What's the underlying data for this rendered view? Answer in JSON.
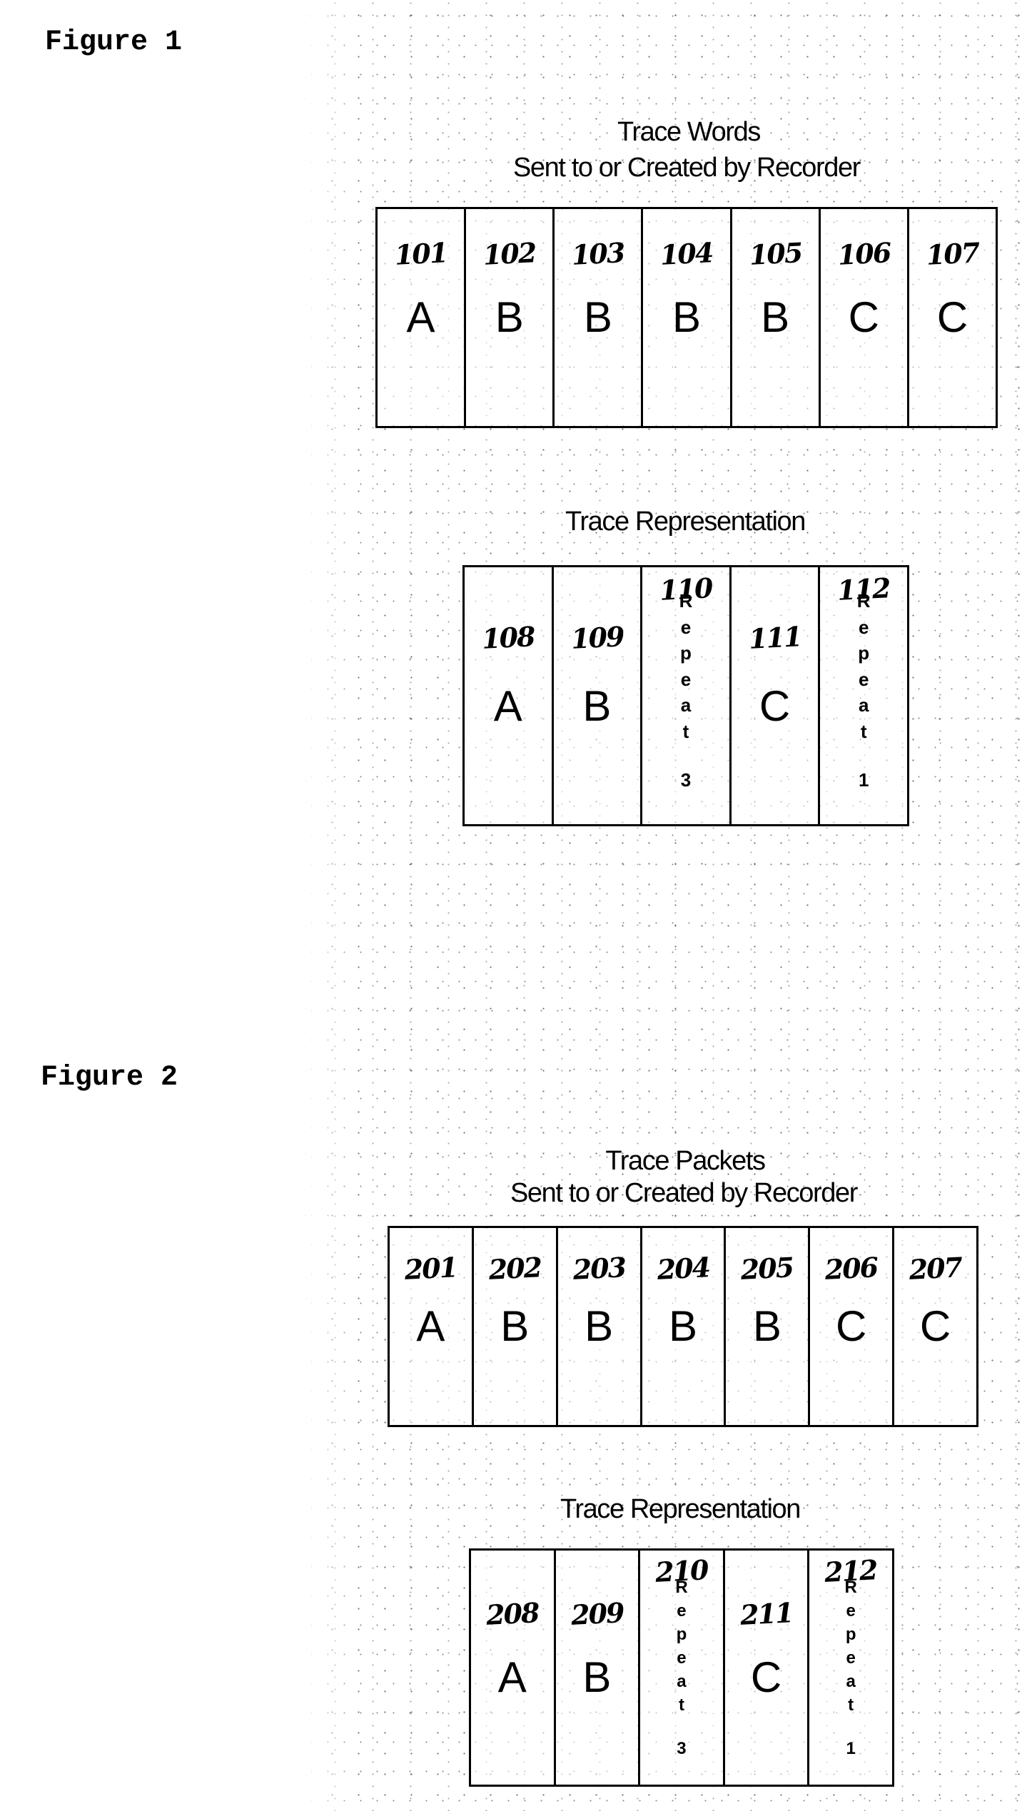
{
  "figure1": {
    "label": "Figure 1",
    "words_title": "Trace Words",
    "words_subtitle": "Sent to or Created by Recorder",
    "words": [
      {
        "ref": "101",
        "symbol": "A"
      },
      {
        "ref": "102",
        "symbol": "B"
      },
      {
        "ref": "103",
        "symbol": "B"
      },
      {
        "ref": "104",
        "symbol": "B"
      },
      {
        "ref": "105",
        "symbol": "B"
      },
      {
        "ref": "106",
        "symbol": "C"
      },
      {
        "ref": "107",
        "symbol": "C"
      }
    ],
    "representation_title": "Trace Representation",
    "representation": [
      {
        "ref": "108",
        "symbol": "A"
      },
      {
        "ref": "109",
        "symbol": "B"
      },
      {
        "ref": "110",
        "repeat_text": [
          "R",
          "e",
          "p",
          "e",
          "a",
          "t"
        ],
        "repeat_count": "3"
      },
      {
        "ref": "111",
        "symbol": "C"
      },
      {
        "ref": "112",
        "repeat_text": [
          "R",
          "e",
          "p",
          "e",
          "a",
          "t"
        ],
        "repeat_count": "1"
      }
    ]
  },
  "figure2": {
    "label": "Figure 2",
    "packets_title": "Trace Packets",
    "packets_subtitle": "Sent to or Created by Recorder",
    "packets": [
      {
        "ref": "201",
        "symbol": "A"
      },
      {
        "ref": "202",
        "symbol": "B"
      },
      {
        "ref": "203",
        "symbol": "B"
      },
      {
        "ref": "204",
        "symbol": "B"
      },
      {
        "ref": "205",
        "symbol": "B"
      },
      {
        "ref": "206",
        "symbol": "C"
      },
      {
        "ref": "207",
        "symbol": "C"
      }
    ],
    "representation_title": "Trace Representation",
    "representation": [
      {
        "ref": "208",
        "symbol": "A"
      },
      {
        "ref": "209",
        "symbol": "B"
      },
      {
        "ref": "210",
        "repeat_text": [
          "R",
          "e",
          "p",
          "e",
          "a",
          "t"
        ],
        "repeat_count": "3"
      },
      {
        "ref": "211",
        "symbol": "C"
      },
      {
        "ref": "212",
        "repeat_text": [
          "R",
          "e",
          "p",
          "e",
          "a",
          "t"
        ],
        "repeat_count": "1"
      }
    ]
  }
}
